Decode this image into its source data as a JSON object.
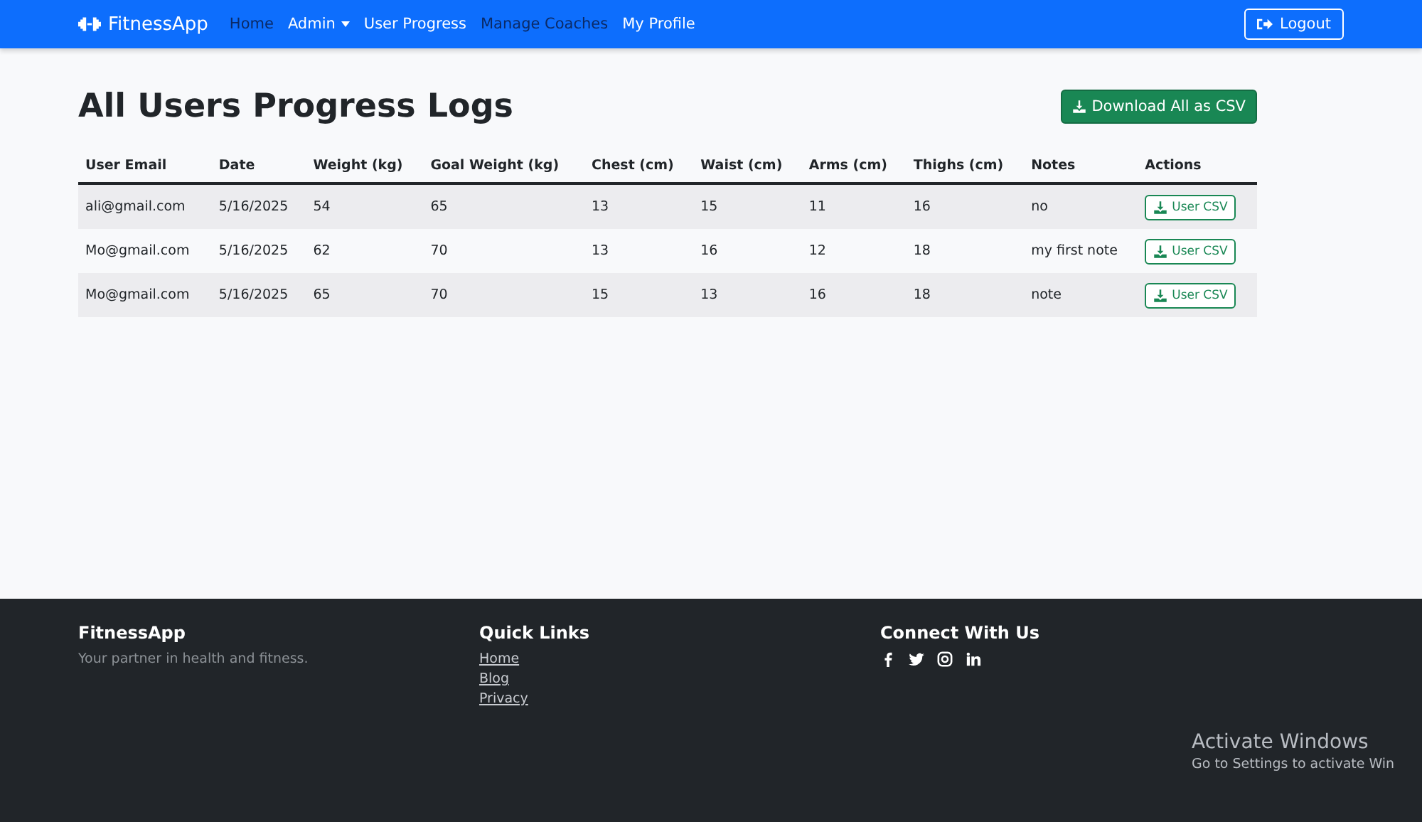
{
  "navbar": {
    "brand": "FitnessApp",
    "links": [
      {
        "label": "Home",
        "highlighted": true,
        "dropdown": false
      },
      {
        "label": "Admin",
        "highlighted": false,
        "dropdown": true
      },
      {
        "label": "User Progress",
        "highlighted": false,
        "dropdown": false
      },
      {
        "label": "Manage Coaches",
        "highlighted": true,
        "dropdown": false
      },
      {
        "label": "My Profile",
        "highlighted": false,
        "dropdown": false
      }
    ],
    "logout": "Logout"
  },
  "page": {
    "title": "All Users Progress Logs",
    "download_button": "Download All as CSV"
  },
  "table": {
    "columns": [
      "User Email",
      "Date",
      "Weight (kg)",
      "Goal Weight (kg)",
      "Chest (cm)",
      "Waist (cm)",
      "Arms (cm)",
      "Thighs (cm)",
      "Notes",
      "Actions"
    ],
    "rows": [
      {
        "cells": [
          "ali@gmail.com",
          "5/16/2025",
          "54",
          "65",
          "13",
          "15",
          "11",
          "16",
          "no"
        ],
        "action": "User CSV"
      },
      {
        "cells": [
          "Mo@gmail.com",
          "5/16/2025",
          "62",
          "70",
          "13",
          "16",
          "12",
          "18",
          "my first note"
        ],
        "action": "User CSV"
      },
      {
        "cells": [
          "Mo@gmail.com",
          "5/16/2025",
          "65",
          "70",
          "15",
          "13",
          "16",
          "18",
          "note"
        ],
        "action": "User CSV"
      }
    ]
  },
  "footer": {
    "brand": "FitnessApp",
    "tagline": "Your partner in health and fitness.",
    "quick_links_title": "Quick Links",
    "quick_links": [
      "Home",
      "Blog",
      "Privacy"
    ],
    "connect_title": "Connect With Us"
  },
  "os_notice": {
    "title": "Activate Windows",
    "subtitle": "Go to Settings to activate Win"
  }
}
